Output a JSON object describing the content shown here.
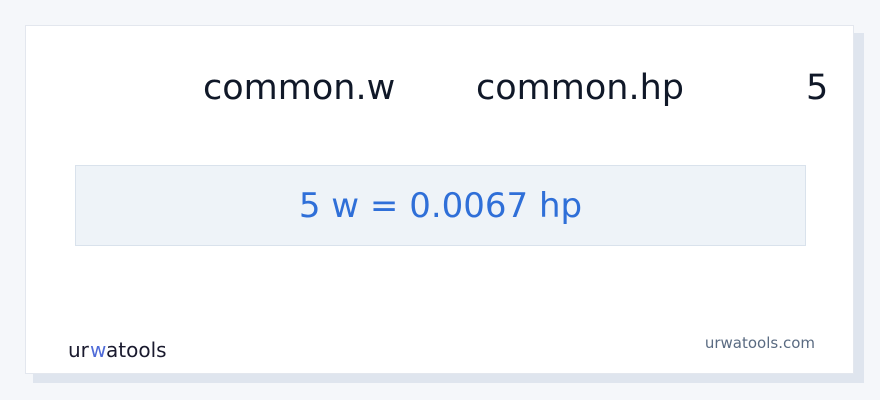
{
  "converter": {
    "from_unit": "common.w",
    "to_unit": "common.hp",
    "amount": "5",
    "result": "5 w = 0.0067 hp"
  },
  "footer": {
    "logo_text": "urwatools",
    "site": "urwatools.com"
  },
  "colors": {
    "result_text": "#2f6fd8",
    "result_bg": "#eef3f8",
    "logo_accent": "#4f6bd8"
  }
}
